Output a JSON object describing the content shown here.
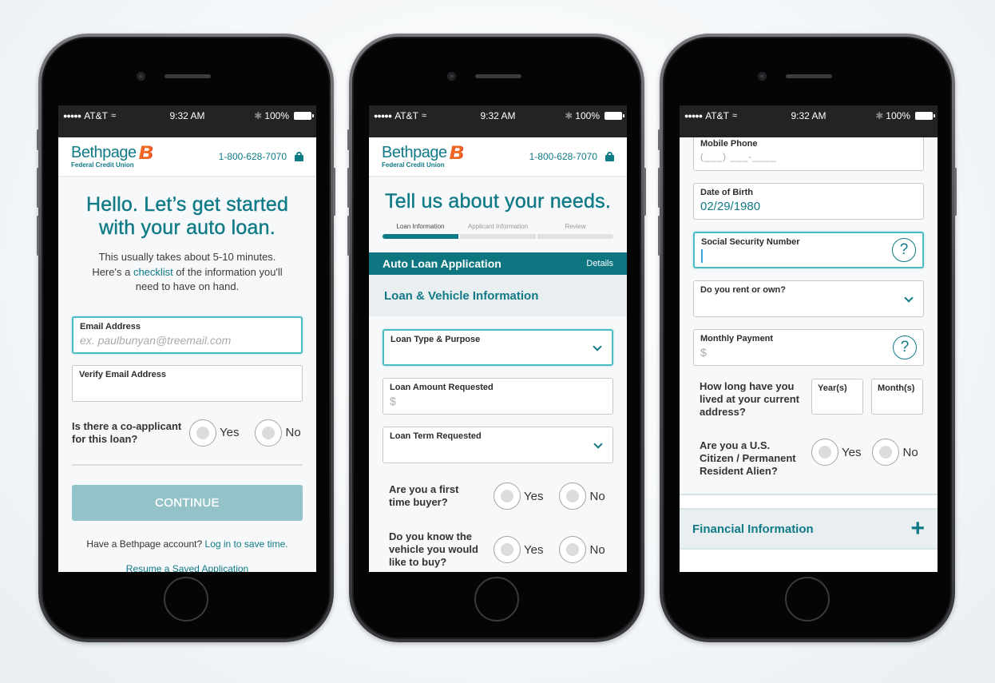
{
  "status_bar": {
    "carrier": "AT&T",
    "signal_dots": "●●●●●",
    "time": "9:32 AM",
    "battery": "100%"
  },
  "header": {
    "logo_name": "Bethpage",
    "logo_mark": "B",
    "logo_sub": "Federal Credit Union",
    "phone": "1-800-628-7070"
  },
  "screen1": {
    "title_line1": "Hello. Let’s get started",
    "title_line2": "with your auto loan.",
    "intro_line1": "This usually takes about 5-10 minutes.",
    "intro_line2_pre": "Here's a ",
    "intro_link": "checklist",
    "intro_line2_post": " of the information you'll",
    "intro_line3": "need to have on hand.",
    "email_label": "Email Address",
    "email_placeholder": "ex. paulbunyan@treemail.com",
    "verify_email_label": "Verify Email Address",
    "coapplicant_question": "Is there a co-applicant for this loan?",
    "yes": "Yes",
    "no": "No",
    "continue": "CONTINUE",
    "account_text": "Have a Bethpage account?",
    "login_link": "Log in to save time.",
    "resume_link": "Resume a Saved Application"
  },
  "screen2": {
    "title": "Tell us about your needs.",
    "progress_steps": [
      "Loan Information",
      "Applicant Information",
      "Review"
    ],
    "progress_current_step": 1,
    "appbar_title": "Auto Loan Application",
    "appbar_details": "Details",
    "section_title": "Loan & Vehicle Information",
    "loan_type_label": "Loan Type & Purpose",
    "loan_amount_label": "Loan Amount Requested",
    "loan_amount_placeholder": "$",
    "loan_term_label": "Loan Term Requested",
    "first_time_question": "Are you a first time buyer?",
    "know_vehicle_question": "Do you know the vehicle you would like to buy?",
    "yes": "Yes",
    "no": "No"
  },
  "screen3": {
    "mobile_label": "Mobile Phone",
    "mobile_placeholder": "(___) ___-____",
    "dob_label": "Date of Birth",
    "dob_value": "02/29/1980",
    "ssn_label": "Social Security Number",
    "rent_own_label": "Do you rent or own?",
    "monthly_payment_label": "Monthly Payment",
    "monthly_payment_placeholder": "$",
    "residence_question": "How long have you lived at your current address?",
    "years_label": "Year(s)",
    "months_label": "Month(s)",
    "citizen_question": "Are you a U.S. Citizen / Permanent Resident Alien?",
    "yes": "Yes",
    "no": "No",
    "financial_section": "Financial Information",
    "help_glyph": "?",
    "plus_glyph": "+"
  }
}
